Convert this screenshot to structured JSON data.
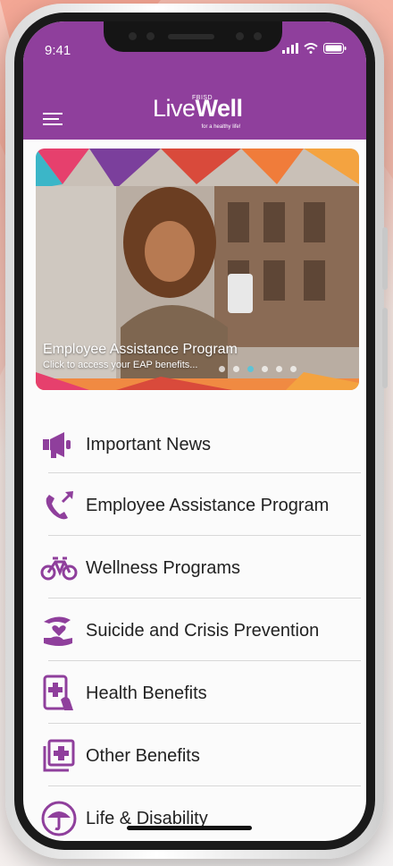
{
  "status": {
    "time": "9:41",
    "icons": [
      "signal-icon",
      "wifi-icon",
      "battery-icon"
    ]
  },
  "header": {
    "logo_prefix": "FBISD",
    "logo_live": "Live",
    "logo_well": "Well",
    "logo_tagline": "for a healthy life!",
    "menu_icon": "hamburger-menu-icon",
    "color": "#8f3f9c"
  },
  "banner": {
    "title": "Employee Assistance Program",
    "subtitle": "Click to access your EAP benefits...",
    "slide_count": 6,
    "active_slide": 3
  },
  "menu": {
    "items": [
      {
        "label": "Important News",
        "icon": "megaphone-icon"
      },
      {
        "label": "Employee Assistance Program",
        "icon": "phone-call-icon"
      },
      {
        "label": "Wellness Programs",
        "icon": "bicycle-icon"
      },
      {
        "label": "Suicide and Crisis Prevention",
        "icon": "caring-hands-icon"
      },
      {
        "label": "Health Benefits",
        "icon": "medical-tablet-icon"
      },
      {
        "label": "Other Benefits",
        "icon": "plus-cards-icon"
      },
      {
        "label": "Life & Disability",
        "icon": "umbrella-icon"
      }
    ]
  },
  "colors": {
    "accent": "#8f3f9c",
    "active_dot": "#5ec3d6"
  }
}
